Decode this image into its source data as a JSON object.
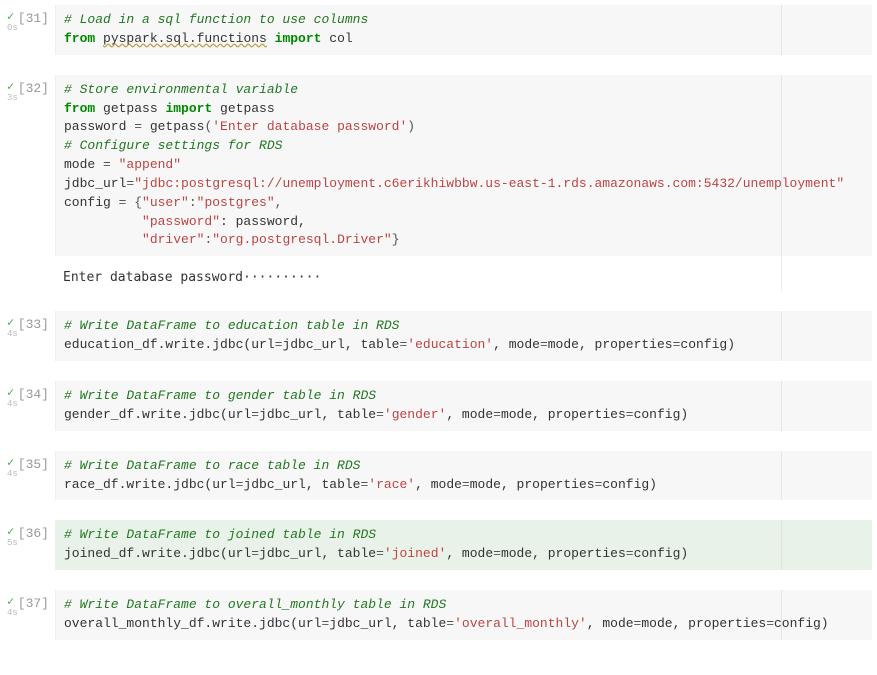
{
  "icons": {
    "check": "✓"
  },
  "cells": [
    {
      "num": "[31]",
      "time": "0s",
      "tokens": [
        [
          [
            "# Load in a sql function to use columns",
            "c-comment"
          ]
        ],
        [
          [
            "from ",
            "c-keyword"
          ],
          [
            "pyspark.sql.functions",
            "wavy c-name"
          ],
          [
            " ",
            "c-name"
          ],
          [
            "import ",
            "c-keyword"
          ],
          [
            "col",
            "c-name"
          ]
        ]
      ]
    },
    {
      "num": "[32]",
      "time": "3s",
      "tokens": [
        [
          [
            "# Store environmental variable",
            "c-comment"
          ]
        ],
        [
          [
            "from ",
            "c-keyword"
          ],
          [
            "getpass ",
            "c-name"
          ],
          [
            "import ",
            "c-keyword"
          ],
          [
            "getpass",
            "c-name"
          ]
        ],
        [
          [
            "password ",
            "c-name"
          ],
          [
            "= ",
            "c-op"
          ],
          [
            "getpass",
            "c-name"
          ],
          [
            "(",
            "c-op"
          ],
          [
            "'Enter database password'",
            "c-string"
          ],
          [
            ")",
            "c-op"
          ]
        ],
        [
          [
            "# Configure settings for RDS",
            "c-comment"
          ]
        ],
        [
          [
            "mode ",
            "c-name"
          ],
          [
            "= ",
            "c-op"
          ],
          [
            "\"append\"",
            "c-string"
          ]
        ],
        [
          [
            "jdbc_url",
            "c-name"
          ],
          [
            "=",
            "c-op"
          ],
          [
            "\"jdbc:postgresql://unemployment.c6erikhiwbbw.us-east-1.rds.amazonaws.com:5432/unemployment\"",
            "c-string"
          ]
        ],
        [
          [
            "config ",
            "c-name"
          ],
          [
            "= {",
            "c-op"
          ],
          [
            "\"user\"",
            "c-string"
          ],
          [
            ":",
            "c-op"
          ],
          [
            "\"postgres\"",
            "c-string"
          ],
          [
            ",",
            "c-op"
          ]
        ],
        [
          [
            "          ",
            "c-name"
          ],
          [
            "\"password\"",
            "c-string"
          ],
          [
            ": password,",
            "c-name"
          ]
        ],
        [
          [
            "          ",
            "c-name"
          ],
          [
            "\"driver\"",
            "c-string"
          ],
          [
            ":",
            "c-op"
          ],
          [
            "\"org.postgresql.Driver\"",
            "c-string"
          ],
          [
            "}",
            "c-op"
          ]
        ]
      ],
      "output": "Enter database password··········"
    },
    {
      "num": "[33]",
      "time": "4s",
      "tokens": [
        [
          [
            "# Write DataFrame to education table in RDS",
            "c-comment"
          ]
        ],
        [
          [
            "education_df.write.jdbc(url",
            "c-name"
          ],
          [
            "=",
            "c-op"
          ],
          [
            "jdbc_url, table",
            "c-name"
          ],
          [
            "=",
            "c-op"
          ],
          [
            "'education'",
            "c-string"
          ],
          [
            ", mode",
            "c-name"
          ],
          [
            "=",
            "c-op"
          ],
          [
            "mode, properties",
            "c-name"
          ],
          [
            "=",
            "c-op"
          ],
          [
            "config)",
            "c-name"
          ]
        ]
      ]
    },
    {
      "num": "[34]",
      "time": "4s",
      "tokens": [
        [
          [
            "# Write DataFrame to gender table in RDS",
            "c-comment"
          ]
        ],
        [
          [
            "gender_df.write.jdbc(url",
            "c-name"
          ],
          [
            "=",
            "c-op"
          ],
          [
            "jdbc_url, table",
            "c-name"
          ],
          [
            "=",
            "c-op"
          ],
          [
            "'gender'",
            "c-string"
          ],
          [
            ", mode",
            "c-name"
          ],
          [
            "=",
            "c-op"
          ],
          [
            "mode, properties",
            "c-name"
          ],
          [
            "=",
            "c-op"
          ],
          [
            "config)",
            "c-name"
          ]
        ]
      ]
    },
    {
      "num": "[35]",
      "time": "4s",
      "tokens": [
        [
          [
            "# Write DataFrame to race table in RDS",
            "c-comment"
          ]
        ],
        [
          [
            "race_df.write.jdbc(url",
            "c-name"
          ],
          [
            "=",
            "c-op"
          ],
          [
            "jdbc_url, table",
            "c-name"
          ],
          [
            "=",
            "c-op"
          ],
          [
            "'race'",
            "c-string"
          ],
          [
            ", mode",
            "c-name"
          ],
          [
            "=",
            "c-op"
          ],
          [
            "mode, properties",
            "c-name"
          ],
          [
            "=",
            "c-op"
          ],
          [
            "config)",
            "c-name"
          ]
        ]
      ]
    },
    {
      "num": "[36]",
      "time": "5s",
      "selected": true,
      "tokens": [
        [
          [
            "# Write DataFrame to joined table in RDS",
            "c-comment"
          ]
        ],
        [
          [
            "joined_df.write.jdbc(url",
            "c-name"
          ],
          [
            "=",
            "c-op"
          ],
          [
            "jdbc_url, table",
            "c-name"
          ],
          [
            "=",
            "c-op"
          ],
          [
            "'joined'",
            "c-string"
          ],
          [
            ", mode",
            "c-name"
          ],
          [
            "=",
            "c-op"
          ],
          [
            "mode, properties",
            "c-name"
          ],
          [
            "=",
            "c-op"
          ],
          [
            "config)",
            "c-name"
          ]
        ]
      ]
    },
    {
      "num": "[37]",
      "time": "4s",
      "tokens": [
        [
          [
            "# Write DataFrame to overall_monthly table in RDS",
            "c-comment"
          ]
        ],
        [
          [
            "overall_monthly_df.write.jdbc(url",
            "c-name"
          ],
          [
            "=",
            "c-op"
          ],
          [
            "jdbc_url, table",
            "c-name"
          ],
          [
            "=",
            "c-op"
          ],
          [
            "'overall_monthly'",
            "c-string"
          ],
          [
            ", mode",
            "c-name"
          ],
          [
            "=",
            "c-op"
          ],
          [
            "mode, properties",
            "c-name"
          ],
          [
            "=",
            "c-op"
          ],
          [
            "config)",
            "c-name"
          ]
        ]
      ]
    }
  ]
}
